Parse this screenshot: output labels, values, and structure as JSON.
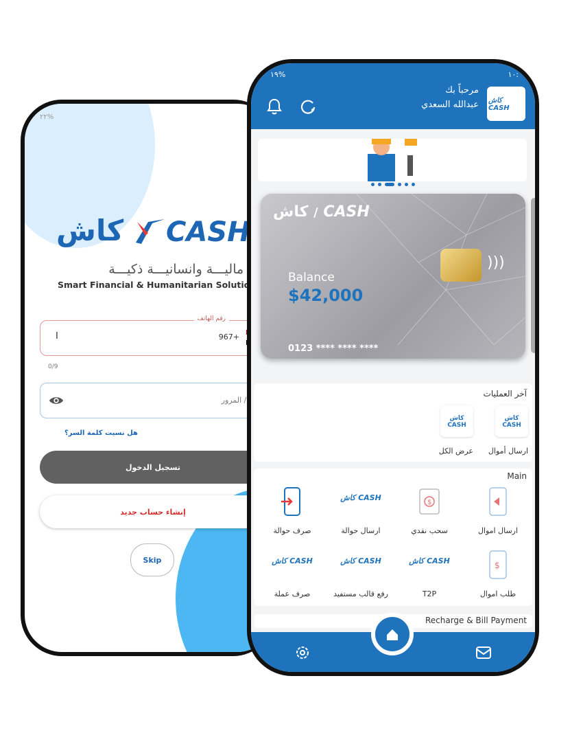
{
  "login": {
    "status_left": "٢٢% ",
    "logo_ar": "كاش",
    "logo_en": "CASH",
    "tagline_ar": "حلــول ماليـــة وانسانيـــة ذكيـــة",
    "tagline_en": "Smart Financial & Humanitarian Solutions",
    "phone_label": "رقم الهاتف",
    "phone_cursor": "I",
    "country_code": "967+",
    "counter": "0/9",
    "pin_placeholder": "المرور / PIN",
    "forgot_link": "هل نسيت كلمة السر؟",
    "login_button": "تسجيل الدخول",
    "create_account_button": "إنشاء حساب جديد",
    "skip_button": "Skip"
  },
  "home": {
    "status_left": "١٩% ",
    "status_right": "١٠:",
    "welcome": "مرحباً بك",
    "user_name": "عبدالله السعدي",
    "card": {
      "logo_ar": "كاش",
      "logo_en": "CASH",
      "balance_label": "Balance",
      "balance_value": "$42,000",
      "card_number": "0123 **** **** ****"
    },
    "recent": {
      "title": "آخر العمليات",
      "items": [
        {
          "label": "ارسال أموال"
        },
        {
          "label": "عرض الكل"
        }
      ]
    },
    "main": {
      "title": "Main",
      "services": [
        {
          "label": "ارسال اموال",
          "icon": "phone-send-icon"
        },
        {
          "label": "سحب نقدي",
          "icon": "cash-withdraw-icon"
        },
        {
          "label": "ارسال حوالة",
          "icon": "cash-logo"
        },
        {
          "label": "صرف حوالة",
          "icon": "phone-transfer-icon"
        },
        {
          "label": "طلب اموال",
          "icon": "request-money-icon"
        },
        {
          "label": "T2P",
          "icon": "cash-logo"
        },
        {
          "label": "رفع قالب مستفيد",
          "icon": "cash-logo"
        },
        {
          "label": "صرف عملة",
          "icon": "cash-logo"
        }
      ]
    },
    "recharge_title": "Recharge & Bill Payment",
    "colors": {
      "primary": "#1f73bd",
      "accent_red": "#d32f2f"
    }
  }
}
